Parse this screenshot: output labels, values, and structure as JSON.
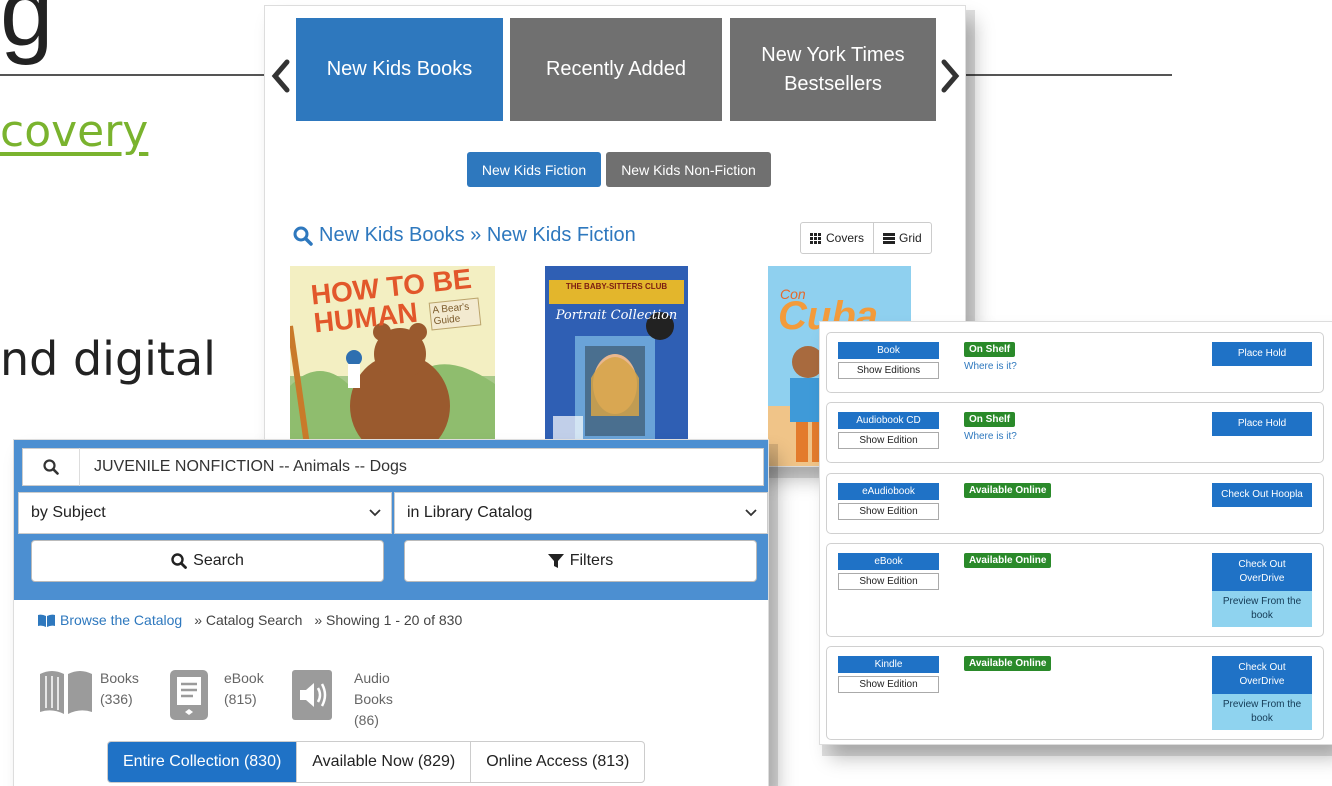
{
  "slide": {
    "heading_fragment": "g",
    "link_fragment": "covery",
    "text_fragment": "nd digital"
  },
  "carousel": {
    "tabs": [
      {
        "label": "New Kids Books"
      },
      {
        "label": "Recently Added"
      },
      {
        "label": "New York Times Bestsellers"
      }
    ],
    "subtabs": [
      {
        "label": "New Kids Fiction"
      },
      {
        "label": "New Kids Non-Fiction"
      }
    ],
    "heading": "New Kids Books » New Kids Fiction",
    "view_covers": "Covers",
    "view_grid": "Grid",
    "covers": [
      {
        "title": "HOW TO BE HUMAN",
        "subtitle": "A Bear's Guide"
      },
      {
        "title": "THE BABY-SITTERS CLUB",
        "subtitle": "Portrait Collection"
      },
      {
        "title": "Cuba",
        "prefix": "Con"
      }
    ]
  },
  "availability": {
    "rows": [
      {
        "format": "Book",
        "sub": "Show Editions",
        "status": "On Shelf",
        "where": "Where is it?",
        "action": "Place Hold"
      },
      {
        "format": "Audiobook CD",
        "sub": "Show Edition",
        "status": "On Shelf",
        "where": "Where is it?",
        "action": "Place Hold"
      },
      {
        "format": "eAudiobook",
        "sub": "Show Edition",
        "status": "Available Online",
        "action": "Check Out Hoopla"
      },
      {
        "format": "eBook",
        "sub": "Show Edition",
        "status": "Available Online",
        "action": "Check Out OverDrive",
        "preview": "Preview From the book"
      },
      {
        "format": "Kindle",
        "sub": "Show Edition",
        "status": "Available Online",
        "action": "Check Out OverDrive",
        "preview": "Preview From the book"
      }
    ]
  },
  "search": {
    "query": "JUVENILE NONFICTION -- Animals -- Dogs",
    "by": "by Subject",
    "scope": "in Library Catalog",
    "search_label": "Search",
    "filters_label": "Filters",
    "crumb_link": "Browse the Catalog",
    "crumb_2": "» Catalog Search",
    "crumb_3": "» Showing 1 - 20 of 830",
    "formats": [
      {
        "line1": "Books",
        "line2": "(336)"
      },
      {
        "line1": "eBook",
        "line2": "(815)"
      },
      {
        "line1": "Audio",
        "line2": "Books",
        "line3": "(86)"
      }
    ],
    "scopes": [
      {
        "label": "Entire Collection (830)"
      },
      {
        "label": "Available Now (829)"
      },
      {
        "label": "Online Access (813)"
      }
    ]
  },
  "colors": {
    "primary": "#2e78be",
    "tab_inactive": "#707070",
    "button_blue": "#1f72c6",
    "status_green": "#2a8a2a",
    "preview_blue": "#8fd3ef",
    "link_green": "#7ab32e"
  }
}
